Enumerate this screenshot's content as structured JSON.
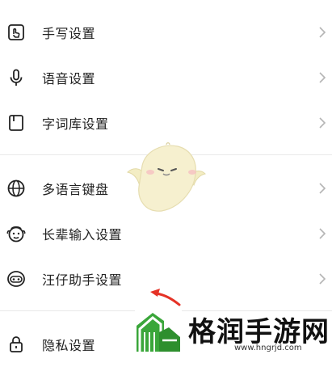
{
  "menu": {
    "items": [
      {
        "label": "手写设置",
        "icon": "handwrite-icon"
      },
      {
        "label": "语音设置",
        "icon": "microphone-icon"
      },
      {
        "label": "字词库设置",
        "icon": "book-icon"
      },
      {
        "label": "多语言键盘",
        "icon": "globe-icon"
      },
      {
        "label": "长辈输入设置",
        "icon": "elder-face-icon"
      },
      {
        "label": "汪仔助手设置",
        "icon": "puppy-icon"
      },
      {
        "label": "隐私设置",
        "icon": "lock-icon"
      }
    ]
  },
  "watermark": {
    "title": "格润手游网",
    "url": "www.hngrjd.com"
  },
  "colors": {
    "arrow": "#e53226",
    "logo_green": "#3aa63a",
    "divider": "#e9e9e9",
    "chevron": "#b5b5b5"
  }
}
